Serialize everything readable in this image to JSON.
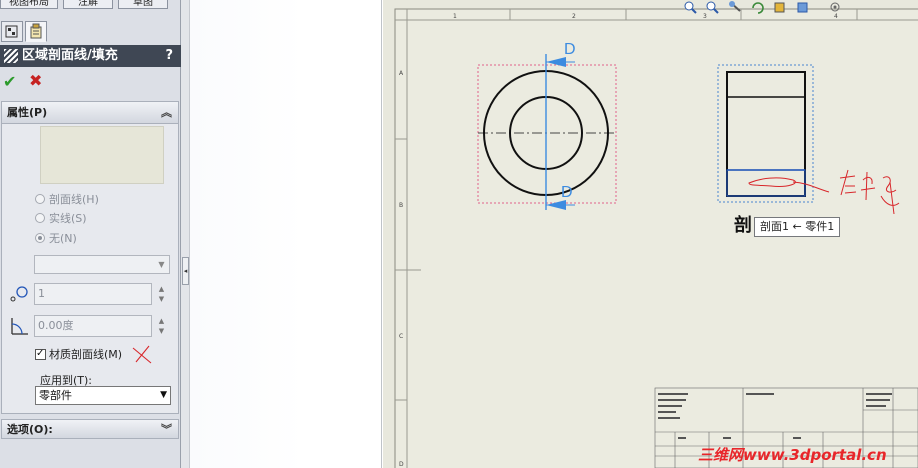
{
  "top_tabs": [
    "视图布局",
    "注解",
    "草图"
  ],
  "property_manager": {
    "title": "区域剖面线/填充",
    "help": "?",
    "ok_symbol": "✔",
    "cancel_symbol": "✖",
    "properties_group": {
      "title": "属性(P)",
      "radios": [
        {
          "label": "剖面线(H)",
          "selected": false
        },
        {
          "label": "实线(S)",
          "selected": false
        },
        {
          "label": "无(N)",
          "selected": true
        }
      ],
      "pattern_select": "",
      "scale_value": "1",
      "angle_value": "0.00度",
      "material_hatch": {
        "label": "材质剖面线(M)",
        "checked": true
      },
      "apply_to_label": "应用到(T):",
      "apply_to_value": "零部件"
    },
    "options_group": {
      "title": "选项(O):"
    }
  },
  "drawing": {
    "section_letter_top": "D",
    "section_letter_bottom": "D",
    "section_view_label": "剖",
    "tooltip": "剖面1 ← 零件1",
    "border_numbers_top": [
      "1",
      "2",
      "3",
      "4"
    ],
    "border_letters_left": [
      "A",
      "B",
      "C",
      "D"
    ],
    "handwritten_note": "左键",
    "watermark": "三维网www.3dportal.cn"
  },
  "colors": {
    "panel_title_bg": "#3f4754",
    "sheet_bg": "#e8e8dd",
    "section_arrow": "#3c8be0",
    "selection_box_pink": "#e0608a",
    "selection_box_blue": "#4a86d0",
    "annotation_red": "#d8262a"
  },
  "icons": [
    "zoom-to-fit-icon",
    "zoom-area-icon",
    "pan-icon",
    "rotate-icon",
    "display-style-icon",
    "view-orientation-icon",
    "hide-show-icon"
  ]
}
